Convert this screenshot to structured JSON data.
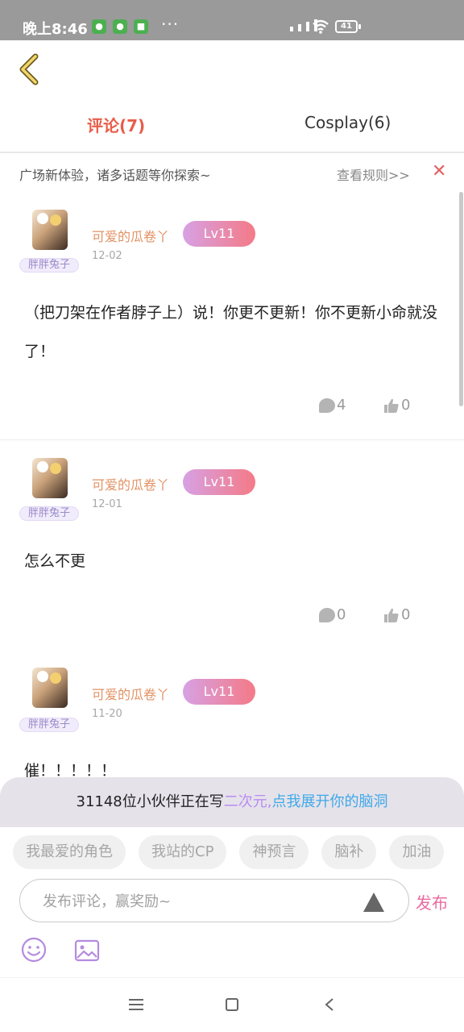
{
  "status_bar": {
    "time": "晚上8:46",
    "dots": "···",
    "battery": "41",
    "icons": [
      "wechat-icon",
      "wechat-icon",
      "shield-icon",
      "signal-icon",
      "wifi-icon",
      "battery-icon"
    ]
  },
  "tabs": [
    {
      "label": "评论(7)",
      "active": true
    },
    {
      "label": "Cosplay(6)",
      "active": false
    }
  ],
  "notice": {
    "text": "广场新体验，诸多话题等你探索~",
    "link": "查看规则>>",
    "close": "✕"
  },
  "comments": [
    {
      "username": "可爱的瓜卷丫",
      "level": "Lv11",
      "pendant": "胖胖兔子",
      "date": "12-02",
      "text": "（把刀架在作者脖子上）说！你更不更新！你不更新小命就没了！",
      "replies": "4",
      "likes": "0"
    },
    {
      "username": "可爱的瓜卷丫",
      "level": "Lv11",
      "pendant": "胖胖兔子",
      "date": "12-01",
      "text": "怎么不更",
      "replies": "0",
      "likes": "0"
    },
    {
      "username": "可爱的瓜卷丫",
      "level": "Lv11",
      "pendant": "胖胖兔子",
      "date": "11-20",
      "text": "催！！！！！",
      "replies": "",
      "likes": ""
    }
  ],
  "promo": {
    "part1": "31148位小伙伴正在写",
    "part2": "二次元,",
    "part3": "点我展开你的脑洞"
  },
  "chips": [
    "我最爱的角色",
    "我站的CP",
    "神预言",
    "脑补",
    "加油"
  ],
  "composer": {
    "placeholder": "发布评论，赢奖励~",
    "publish_label": "发布"
  },
  "colors": {
    "accent": "#e85d4a",
    "username": "#e29264",
    "publish": "#e86ca0",
    "promo_purple": "#b88cf2",
    "promo_blue": "#3fa9e8"
  }
}
